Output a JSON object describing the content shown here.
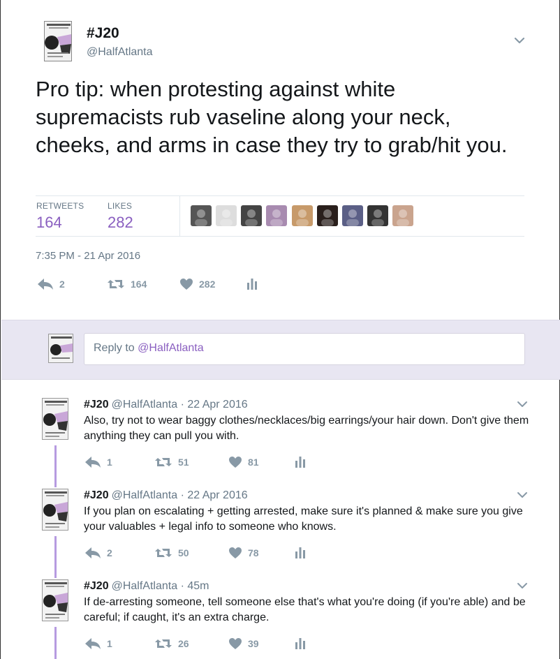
{
  "main_tweet": {
    "display_name": "#J20",
    "handle": "@HalfAtlanta",
    "text": "Pro tip: when protesting against white supremacists rub vaseline along your neck, cheeks, and arms in case they try to grab/hit you.",
    "stats": {
      "retweets_label": "RETWEETS",
      "retweets": "164",
      "likes_label": "LIKES",
      "likes": "282"
    },
    "timestamp": "7:35 PM - 21 Apr 2016",
    "actions": {
      "replies": "2",
      "retweets": "164",
      "likes": "282"
    }
  },
  "likers": [
    "#555555",
    "#dddddd",
    "#444444",
    "#a88bb0",
    "#c79a6a",
    "#2a1f1c",
    "#5b5f86",
    "#333333",
    "#caa48e"
  ],
  "reply_box": {
    "prefix": "Reply to ",
    "mention": "@HalfAtlanta"
  },
  "thread": [
    {
      "name": "#J20",
      "handle": "@HalfAtlanta",
      "time": "· 22 Apr 2016",
      "text": "Also, try not to wear baggy clothes/necklaces/big earrings/your hair down. Don't give them anything they can pull you with.",
      "replies": "1",
      "retweets": "51",
      "likes": "81"
    },
    {
      "name": "#J20",
      "handle": "@HalfAtlanta",
      "time": "· 22 Apr 2016",
      "text": "If you plan on escalating + getting arrested, make sure it's planned & make sure you give your valuables + legal info to someone who knows.",
      "replies": "2",
      "retweets": "50",
      "likes": "78"
    },
    {
      "name": "#J20",
      "handle": "@HalfAtlanta",
      "time": "· 45m",
      "text": "If de-arresting someone, tell someone else that's what you're doing (if you're able) and be careful; if caught, it's an extra charge.",
      "replies": "1",
      "retweets": "26",
      "likes": "39"
    }
  ],
  "colors": {
    "accent": "#8a5fc0",
    "icon_gray": "#8899a6",
    "reply_band": "#e8e6f2",
    "thread_line": "#b69be0"
  }
}
